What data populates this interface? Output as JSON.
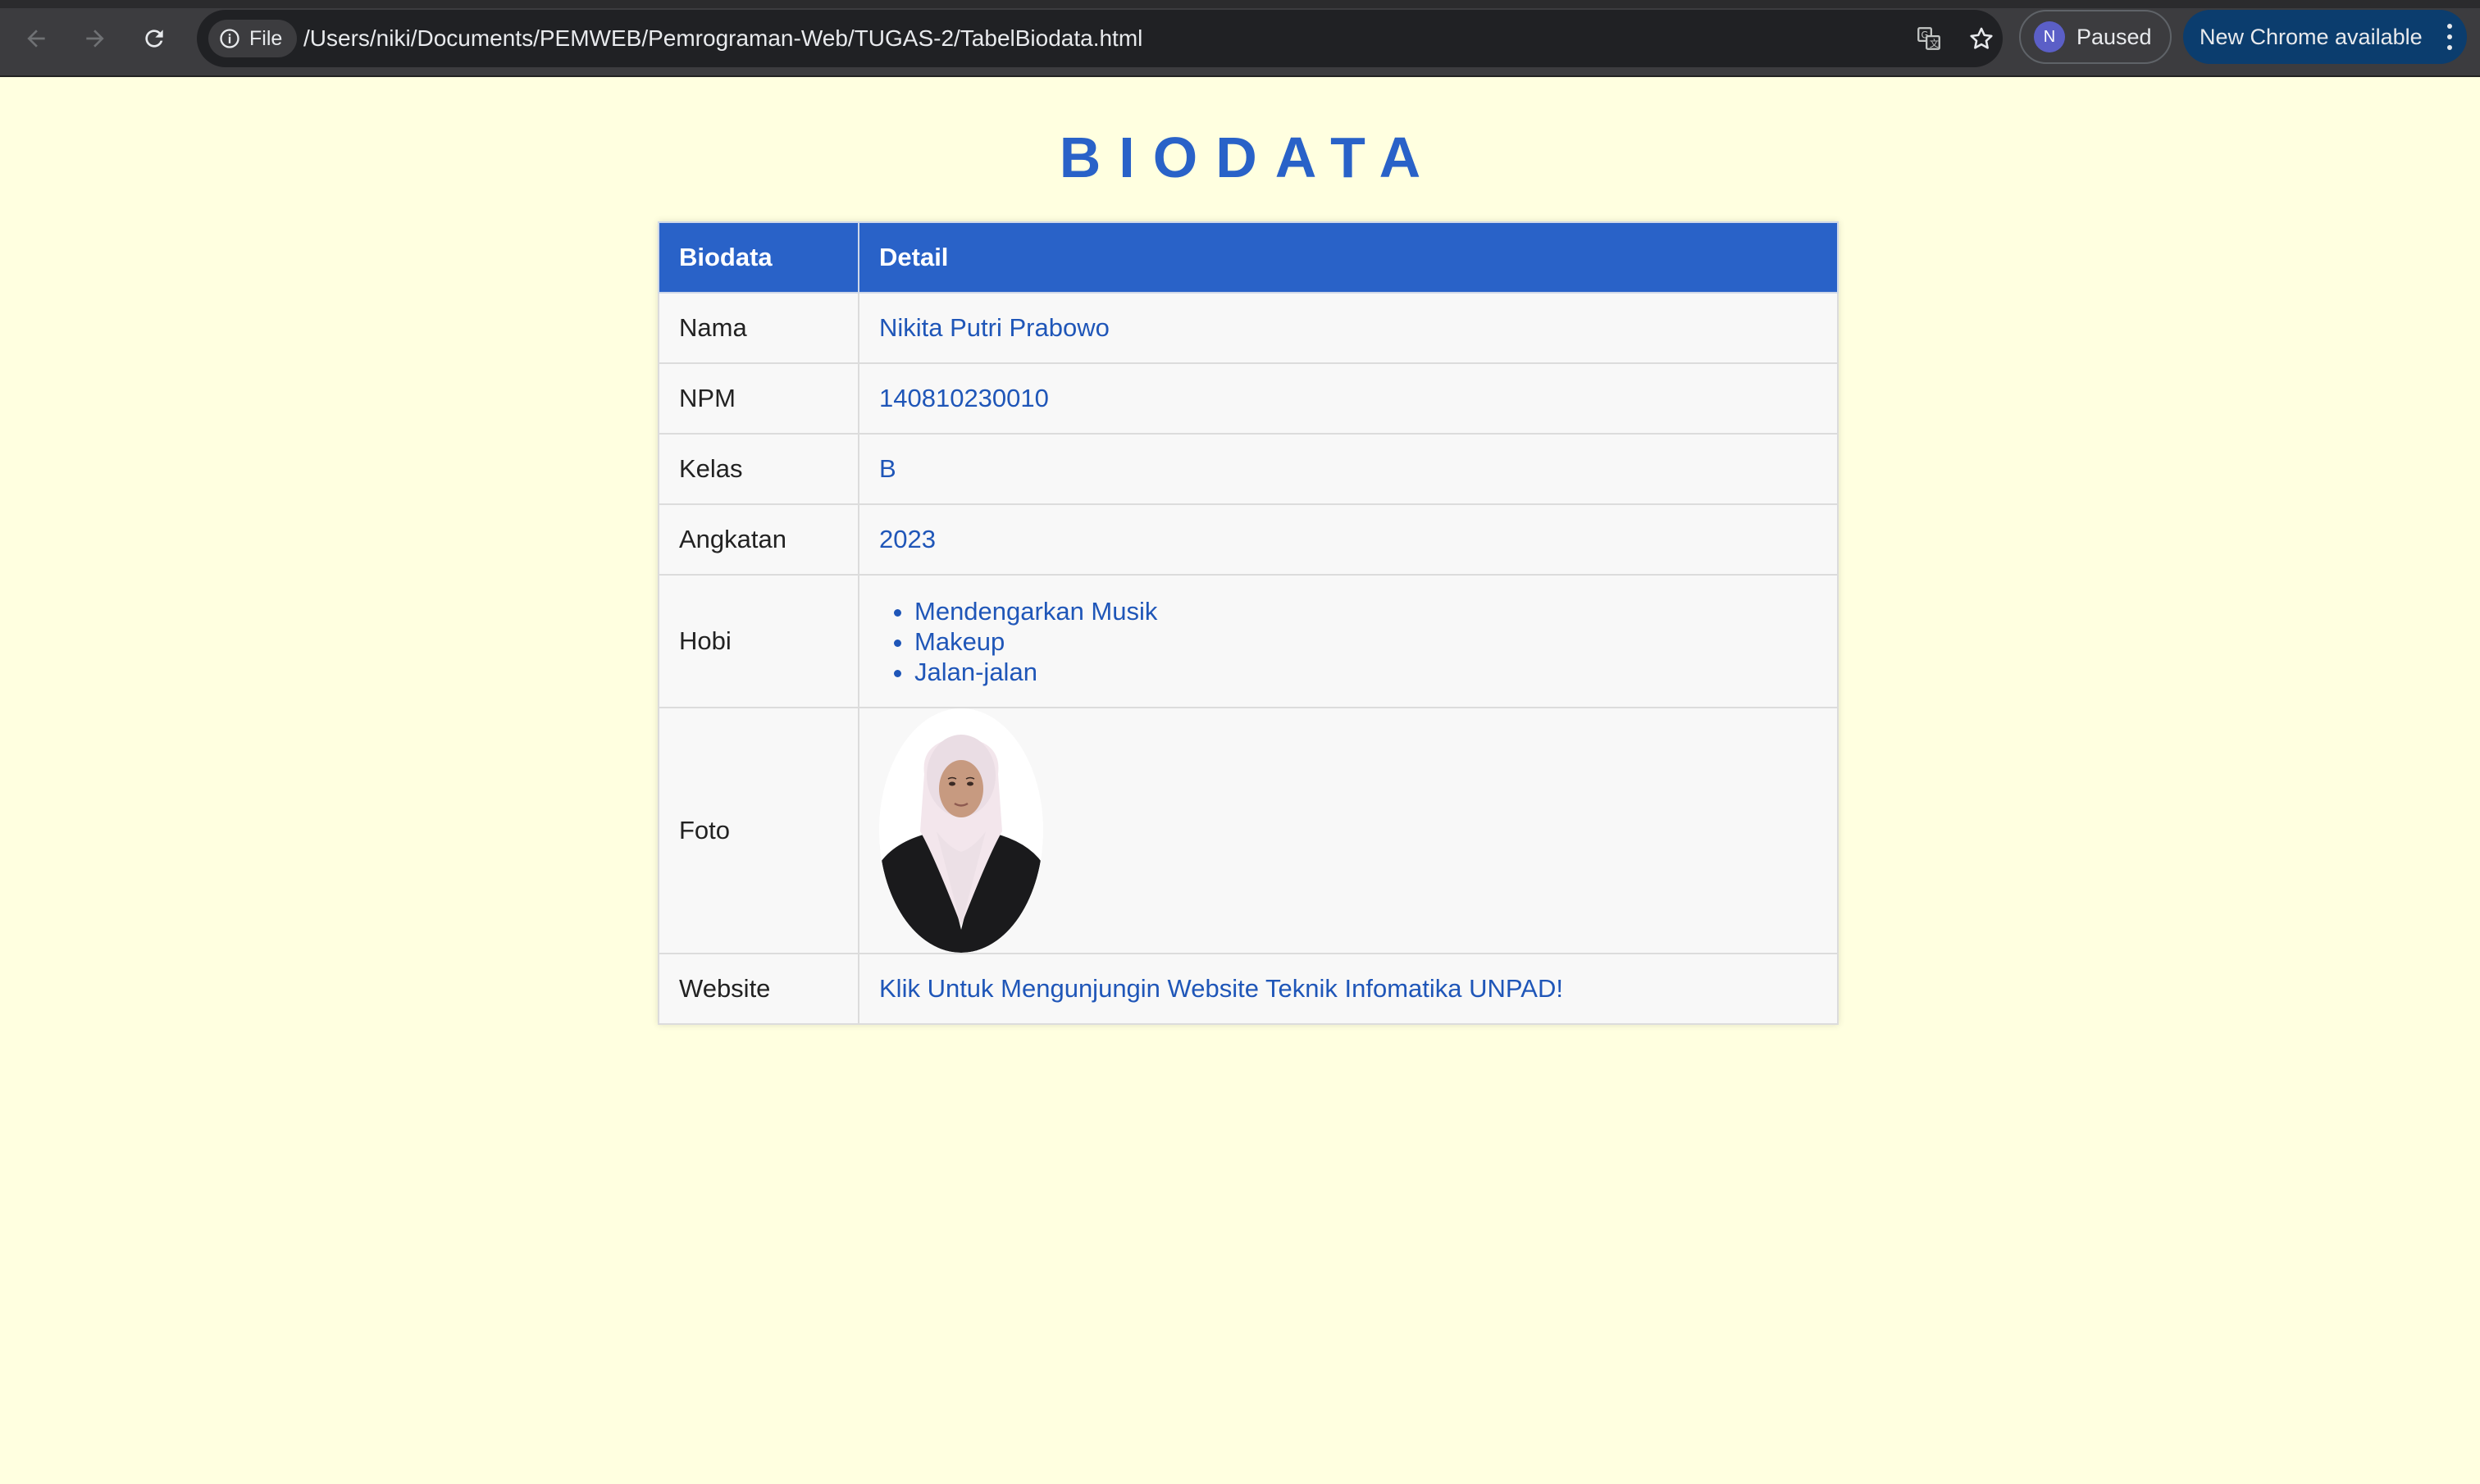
{
  "browser": {
    "file_chip": "File",
    "url": "/Users/niki/Documents/PEMWEB/Pemrograman-Web/TUGAS-2/TabelBiodata.html",
    "profile_initial": "N",
    "profile_status": "Paused",
    "update_label": "New Chrome available"
  },
  "page": {
    "title": "BIODATA",
    "table": {
      "headers": [
        "Biodata",
        "Detail"
      ],
      "rows": {
        "nama": {
          "label": "Nama",
          "value": "Nikita Putri Prabowo"
        },
        "npm": {
          "label": "NPM",
          "value": "140810230010"
        },
        "kelas": {
          "label": "Kelas",
          "value": "B"
        },
        "angkatan": {
          "label": "Angkatan",
          "value": "2023"
        },
        "hobi": {
          "label": "Hobi",
          "items": [
            "Mendengarkan Musik",
            "Makeup",
            "Jalan-jalan"
          ]
        },
        "foto": {
          "label": "Foto"
        },
        "website": {
          "label": "Website",
          "link_text": "Klik Untuk Mengunjungin Website Teknik Infomatika UNPAD!"
        }
      }
    }
  },
  "colors": {
    "page_bg": "#ffffe0",
    "accent": "#2962c8",
    "link": "#1f56b8",
    "chrome_bg": "#3c3c3f"
  },
  "icons": [
    "back-arrow-icon",
    "forward-arrow-icon",
    "reload-icon",
    "info-icon",
    "translate-icon",
    "star-icon",
    "more-menu-icon"
  ]
}
